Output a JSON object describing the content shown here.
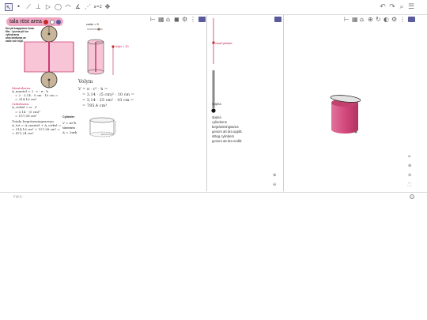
{
  "toolbar": {
    "tools": [
      {
        "name": "move-tool",
        "glyph": "↖"
      },
      {
        "name": "point-tool",
        "glyph": "•"
      },
      {
        "name": "line-tool",
        "glyph": "⟋"
      },
      {
        "name": "perpendicular-tool",
        "glyph": "⊥"
      },
      {
        "name": "polygon-tool",
        "glyph": "▷"
      },
      {
        "name": "circle-tool",
        "glyph": "◯"
      },
      {
        "name": "arc-tool",
        "glyph": "◠"
      },
      {
        "name": "angle-tool",
        "glyph": "∡"
      },
      {
        "name": "reflect-tool",
        "glyph": "⋰"
      },
      {
        "name": "slider-tool",
        "glyph": "a=2"
      },
      {
        "name": "move-view-tool",
        "glyph": "✥"
      }
    ],
    "right": [
      {
        "name": "undo-icon",
        "glyph": "↶"
      },
      {
        "name": "redo-icon",
        "glyph": "↷"
      },
      {
        "name": "search-icon",
        "glyph": "⌕"
      },
      {
        "name": "menu-icon",
        "glyph": "☰"
      }
    ]
  },
  "title_pill": {
    "text": "tala röst area"
  },
  "instructions": [
    "Dra på knapparna innan",
    "Mer - lyssna på hur",
    "cylindrarna",
    "area beräknas av",
    "radie och höjd."
  ],
  "slider_radie": {
    "label": "radie = 5"
  },
  "slider_hojd": {
    "label": "höjd = 10"
  },
  "mantelarea": {
    "title": "Mantelarea",
    "lines": [
      "A_mantel = 2 · r · π · h",
      "= 2 · 3,14 · 5 cm · 10 cm =",
      "= 314,16 cm²"
    ]
  },
  "cirkelarea": {
    "title": "Cirkelarea",
    "lines": [
      "A_cirkel = π · r²",
      "= 3,14 · (5 cm)²",
      "= 157,08 cm²"
    ]
  },
  "total": {
    "title": "Totala begränsningsarean",
    "lines": [
      "A_tot = A_mantel + A_cirkel =",
      "= 314,16 cm² + 157,08 cm² =",
      "= 471,24 cm²"
    ]
  },
  "volym": {
    "title": "Volym",
    "lines": [
      "V = π · r² · h =",
      "= 3,14 · (5 cm)² · 10 cm =",
      "= 3,14 · 25 cm² · 10 cm =",
      "= 785,4 cm³"
    ]
  },
  "cylinder_card": {
    "title": "Cylinder",
    "formula": "V = πr²h",
    "mantel_label": "Mantelarea",
    "mantel_formula": "A = 2πrh"
  },
  "middle_panel": {
    "visa_label": "visaCylinder",
    "oppna_label": "öppna",
    "options": [
      "öppna",
      "cylinderns",
      "begränsningsarea",
      "genom att dra uppåt.",
      "stäng cylindern",
      "genom att dra nedåt"
    ]
  },
  "input_bar": {
    "placeholder": "Input..."
  },
  "colors": {
    "accent_pink": "#f0a8c4",
    "surface_pink": "#f7c5d6",
    "cylinder_3d": "#d94c7f",
    "wheel_brown": "#c8b59a",
    "red": "#c2185b",
    "stylebar_blue": "#5b5b9c"
  }
}
